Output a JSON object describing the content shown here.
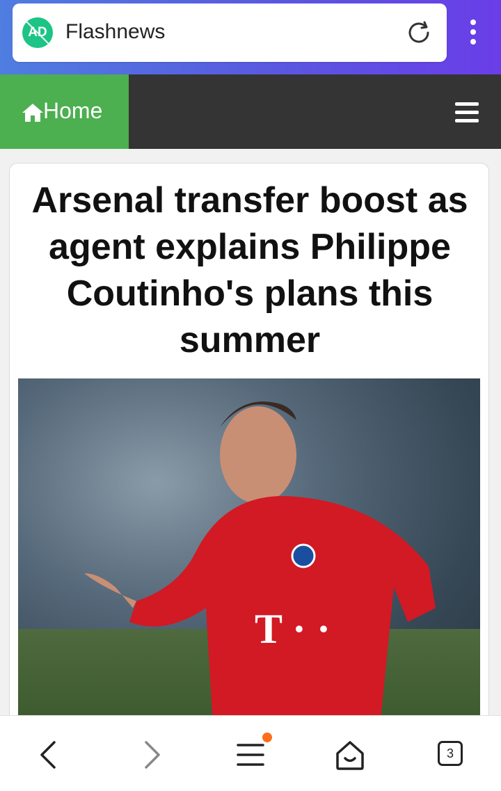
{
  "browser": {
    "badge_text": "AD",
    "address_title": "Flashnews",
    "tabs_count": "3",
    "colors": {
      "accent_gradient_start": "#4f7de0",
      "accent_gradient_end": "#6a3de8",
      "badge": "#1cc486",
      "notification_dot": "#ff6d1a"
    }
  },
  "nav": {
    "home_label": "Home",
    "colors": {
      "home_bg": "#4caf50",
      "bar_bg": "#343434"
    }
  },
  "article": {
    "headline": "Arsenal transfer boost as agent explains Philippe Coutinho's plans this summer"
  },
  "icons": [
    "ad-block-icon",
    "reload-icon",
    "more-vert-icon",
    "home-icon",
    "hamburger-menu-icon",
    "back-icon",
    "forward-icon",
    "menu-icon",
    "home-tab-icon",
    "tabs-icon"
  ]
}
